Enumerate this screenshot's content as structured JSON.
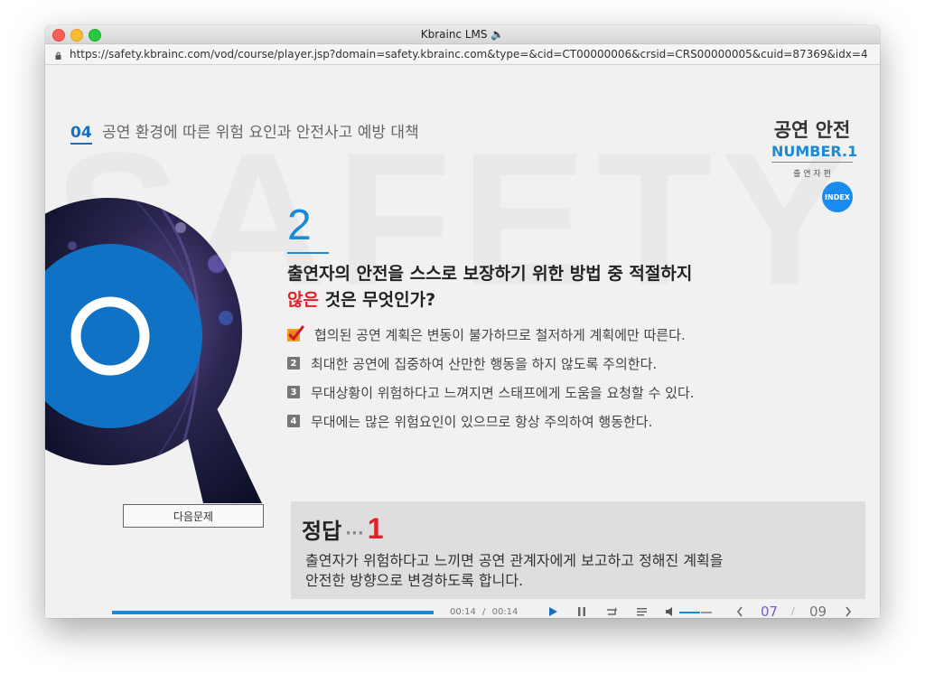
{
  "window": {
    "title": "Kbrainc LMS 🔈",
    "url": "https://safety.kbrainc.com/vod/course/player.jsp?domain=safety.kbrainc.com&type=&cid=CT00000006&crsid=CRS00000005&cuid=87369&idx=4"
  },
  "header": {
    "section_num": "04",
    "section_title": "공연 환경에 따른 위험 요인과 안전사고 예방 대책",
    "brand_title": "공연 안전",
    "brand_number": "NUMBER.1",
    "brand_sub": "출 연 자 편",
    "index_label": "INDEX"
  },
  "quiz": {
    "number": "2",
    "question_line1": "출연자의 안전을 스스로 보장하기 위한 방법 중 적절하지",
    "question_red": "않은",
    "question_line2_rest": " 것은 무엇인가?",
    "options": [
      {
        "marker": "",
        "text": "협의된 공연 계획은 변동이 불가하므로 철저하게 계획에만 따른다."
      },
      {
        "marker": "2",
        "text": "최대한 공연에 집중하여 산만한 행동을 하지 않도록 주의한다."
      },
      {
        "marker": "3",
        "text": "무대상황이 위험하다고 느껴지면 스태프에게 도움을 요청할 수 있다."
      },
      {
        "marker": "4",
        "text": "무대에는 많은 위험요인이 있으므로 항상 주의하여 행동한다."
      }
    ],
    "next_label": "다음문제"
  },
  "answer": {
    "label": "정답",
    "dots": "···",
    "number": "1",
    "explanation_line1": "출연자가 위험하다고 느끼면 공연 관계자에게 보고하고 정해진 계획을",
    "explanation_line2": "안전한 방향으로 변경하도록 합니다."
  },
  "player": {
    "progress": 1.0,
    "time_current": "00:14",
    "time_sep": "/",
    "time_total": "00:14",
    "page_current": "07",
    "page_sep": "/",
    "page_total": "09",
    "volume": 0.65
  },
  "colors": {
    "accent_blue": "#1a8ad6",
    "red": "#e0202a",
    "page_purple": "#7a56d8"
  }
}
